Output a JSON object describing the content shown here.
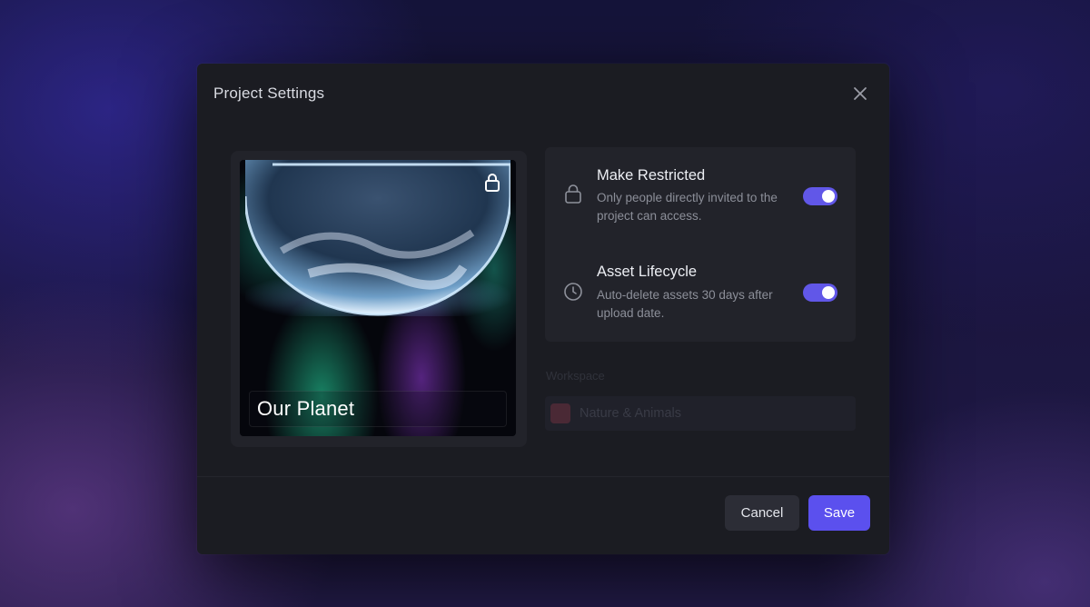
{
  "modal": {
    "title": "Project Settings",
    "close_icon": "close-icon"
  },
  "cover": {
    "title": "Our Planet",
    "lock_icon": "lock-icon"
  },
  "options": [
    {
      "icon": "lock-icon",
      "title": "Make Restricted",
      "description": "Only people directly invited to the project can access.",
      "enabled": true
    },
    {
      "icon": "clock-icon",
      "title": "Asset Lifecycle",
      "description": "Auto-delete assets 30 days after upload date.",
      "enabled": true
    }
  ],
  "workspace": {
    "label": "Workspace",
    "value": "Nature & Animals",
    "swatch_color": "#4a2935"
  },
  "footer": {
    "cancel_label": "Cancel",
    "save_label": "Save"
  },
  "colors": {
    "accent": "#5b50ee",
    "toggle_on": "#6157e8"
  }
}
